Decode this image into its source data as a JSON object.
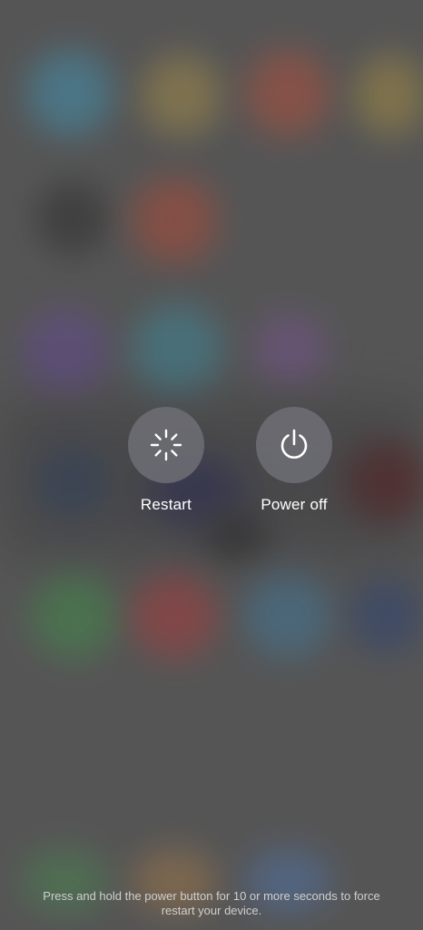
{
  "power_menu": {
    "actions": [
      {
        "label": "Restart",
        "icon": "restart-spinner-icon"
      },
      {
        "label": "Power off",
        "icon": "power-icon"
      }
    ],
    "hint": "Press and hold the power button for 10 or more seconds to force restart your device."
  },
  "colors": {
    "button_bg": "#6e6e76",
    "label_text": "#ffffff",
    "hint_text": "#cfcfcf",
    "background": "#5f5f5f"
  }
}
